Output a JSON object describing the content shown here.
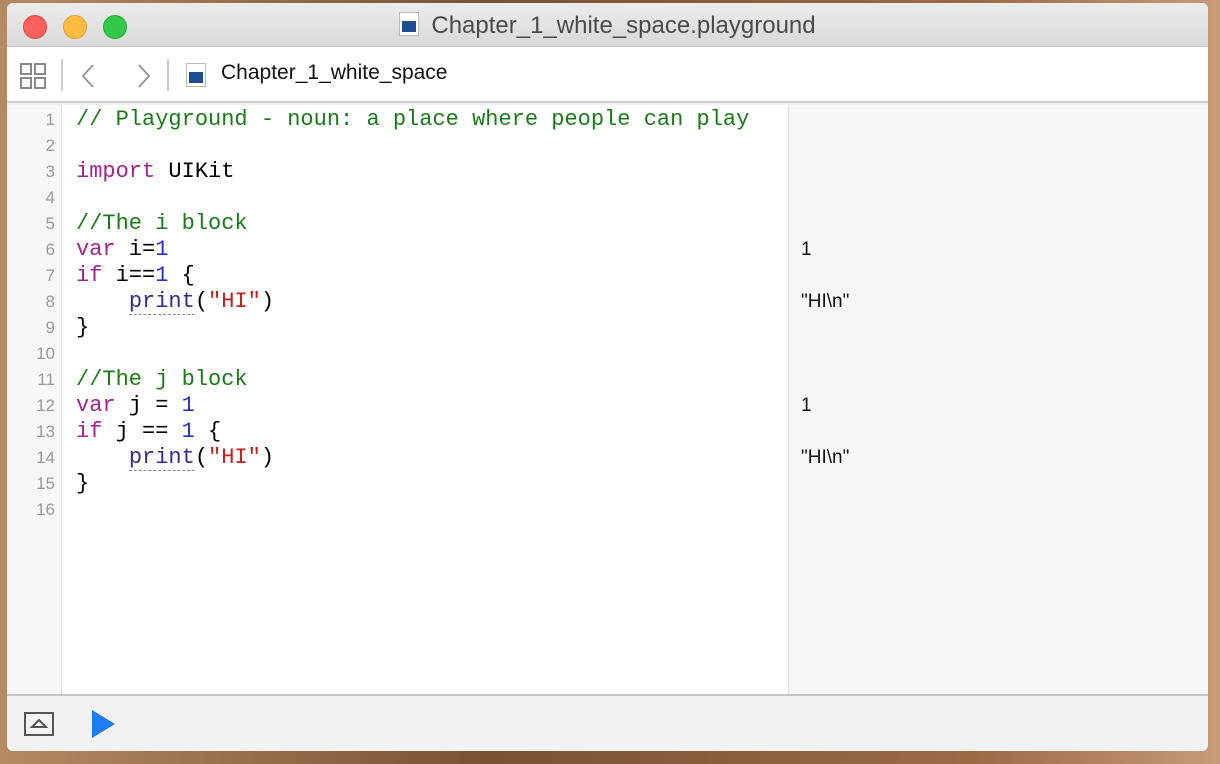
{
  "window": {
    "title": "Chapter_1_white_space.playground"
  },
  "toolbar": {
    "breadcrumb": "Chapter_1_white_space"
  },
  "lines": [
    {
      "num": "1",
      "segs": [
        {
          "t": "// Playground - noun: a place where people can play",
          "c": "c"
        }
      ]
    },
    {
      "num": "2",
      "segs": []
    },
    {
      "num": "3",
      "segs": [
        {
          "t": "import",
          "c": "k"
        },
        {
          "t": " UIKit",
          "c": ""
        }
      ]
    },
    {
      "num": "4",
      "segs": []
    },
    {
      "num": "5",
      "segs": [
        {
          "t": "//The i block",
          "c": "c"
        }
      ]
    },
    {
      "num": "6",
      "segs": [
        {
          "t": "var",
          "c": "k"
        },
        {
          "t": " i=",
          "c": ""
        },
        {
          "t": "1",
          "c": "n"
        }
      ]
    },
    {
      "num": "7",
      "segs": [
        {
          "t": "if",
          "c": "k"
        },
        {
          "t": " i",
          "c": ""
        },
        {
          "t": "==",
          "c": ""
        },
        {
          "t": "1",
          "c": "n"
        },
        {
          "t": " {",
          "c": ""
        }
      ]
    },
    {
      "num": "8",
      "segs": [
        {
          "t": "    ",
          "c": ""
        },
        {
          "t": "print",
          "c": "f"
        },
        {
          "t": "(",
          "c": ""
        },
        {
          "t": "\"HI\"",
          "c": "s"
        },
        {
          "t": ")",
          "c": ""
        }
      ]
    },
    {
      "num": "9",
      "segs": [
        {
          "t": "}",
          "c": ""
        }
      ]
    },
    {
      "num": "10",
      "segs": []
    },
    {
      "num": "11",
      "segs": [
        {
          "t": "//The j block",
          "c": "c"
        }
      ]
    },
    {
      "num": "12",
      "segs": [
        {
          "t": "var",
          "c": "k"
        },
        {
          "t": " j = ",
          "c": ""
        },
        {
          "t": "1",
          "c": "n"
        }
      ]
    },
    {
      "num": "13",
      "segs": [
        {
          "t": "if",
          "c": "k"
        },
        {
          "t": " j == ",
          "c": ""
        },
        {
          "t": "1",
          "c": "n"
        },
        {
          "t": " {",
          "c": ""
        }
      ]
    },
    {
      "num": "14",
      "segs": [
        {
          "t": "    ",
          "c": ""
        },
        {
          "t": "print",
          "c": "f"
        },
        {
          "t": "(",
          "c": ""
        },
        {
          "t": "\"HI\"",
          "c": "s"
        },
        {
          "t": ")",
          "c": ""
        }
      ]
    },
    {
      "num": "15",
      "segs": [
        {
          "t": "}",
          "c": ""
        }
      ]
    },
    {
      "num": "16",
      "segs": []
    }
  ],
  "results": [
    {
      "line": 6,
      "text": "1"
    },
    {
      "line": 8,
      "text": "\"HI\\n\""
    },
    {
      "line": 12,
      "text": "1"
    },
    {
      "line": 14,
      "text": "\"HI\\n\""
    }
  ],
  "colors": {
    "close": "#fc605c",
    "minimize": "#fdbc40",
    "zoom": "#34c84a",
    "run": "#1f7ef5"
  }
}
